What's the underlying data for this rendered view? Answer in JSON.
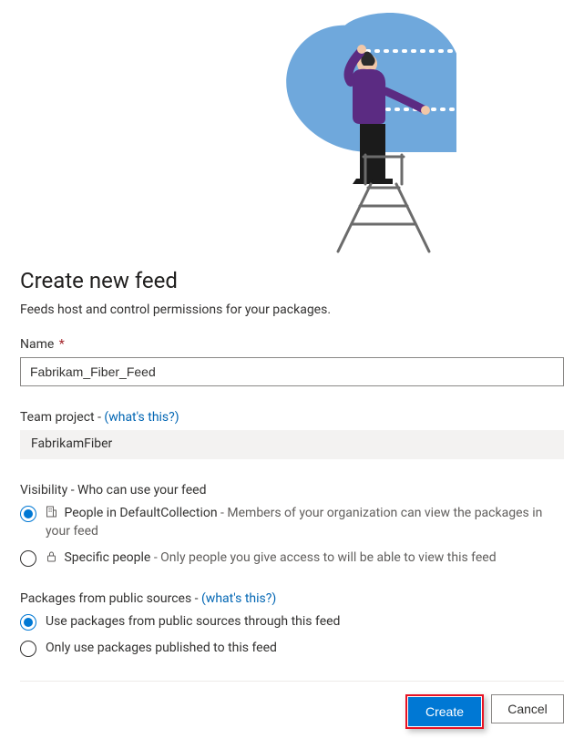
{
  "title": "Create new feed",
  "subtitle": "Feeds host and control permissions for your packages.",
  "name": {
    "label": "Name",
    "required_marker": "*",
    "value": "Fabrikam_Fiber_Feed"
  },
  "team_project": {
    "label_prefix": "Team project - ",
    "help_link": "(what's this?)",
    "value": "FabrikamFiber"
  },
  "visibility": {
    "label": "Visibility - Who can use your feed",
    "options": [
      {
        "title_prefix": "People in DefaultCollection",
        "sep": " - ",
        "desc": "Members of your organization can view the packages in your feed",
        "icon": "org-icon",
        "checked": true
      },
      {
        "title_prefix": "Specific people",
        "sep": " - ",
        "desc": "Only people you give access to will be able to view this feed",
        "icon": "lock-icon",
        "checked": false
      }
    ]
  },
  "public_sources": {
    "label_prefix": "Packages from public sources - ",
    "help_link": "(what's this?)",
    "options": [
      {
        "label": "Use packages from public sources through this feed",
        "checked": true
      },
      {
        "label": "Only use packages published to this feed",
        "checked": false
      }
    ]
  },
  "buttons": {
    "create": "Create",
    "cancel": "Cancel"
  }
}
